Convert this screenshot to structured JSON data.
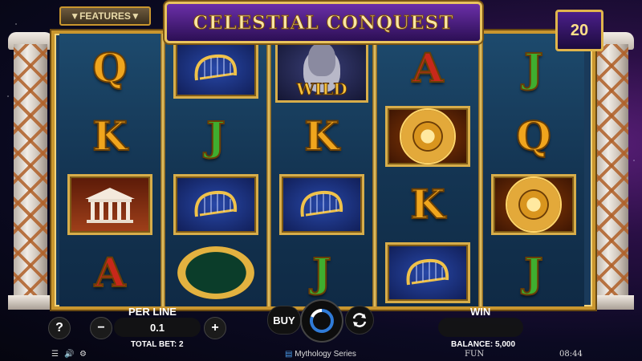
{
  "title": "CELESTIAL CONQUEST",
  "features_label": "▼FEATURES▼",
  "lines_count": "20",
  "reels": [
    [
      "Q",
      "K",
      "temple-tile",
      "A"
    ],
    [
      "harp-tile",
      "J",
      "harp-tile",
      "ring-tile"
    ],
    [
      "wild-tile",
      "K",
      "harp-tile",
      "J"
    ],
    [
      "A",
      "shield-tile",
      "K",
      "harp-tile"
    ],
    [
      "J",
      "Q",
      "shield-tile",
      "J"
    ]
  ],
  "wild_text": "WILD",
  "letters": {
    "r0c0": "Q",
    "r1c0": "K",
    "r3c0": "A",
    "r1c1": "J",
    "r3c2": "J",
    "r1c2": "K",
    "r0c3": "A",
    "r2c3": "K",
    "r0c4": "J",
    "r1c4": "Q",
    "r3c4": "J"
  },
  "controls": {
    "per_line_label": "PER LINE",
    "per_line_value": "0.1",
    "minus": "−",
    "plus": "+",
    "help": "?",
    "total_bet": "TOTAL BET: 2",
    "buy": "BUY",
    "win_label": "WIN",
    "balance": "BALANCE: 5,000"
  },
  "footer": {
    "series": "Mythology Series",
    "mode": "FUN",
    "time": "08:44"
  }
}
